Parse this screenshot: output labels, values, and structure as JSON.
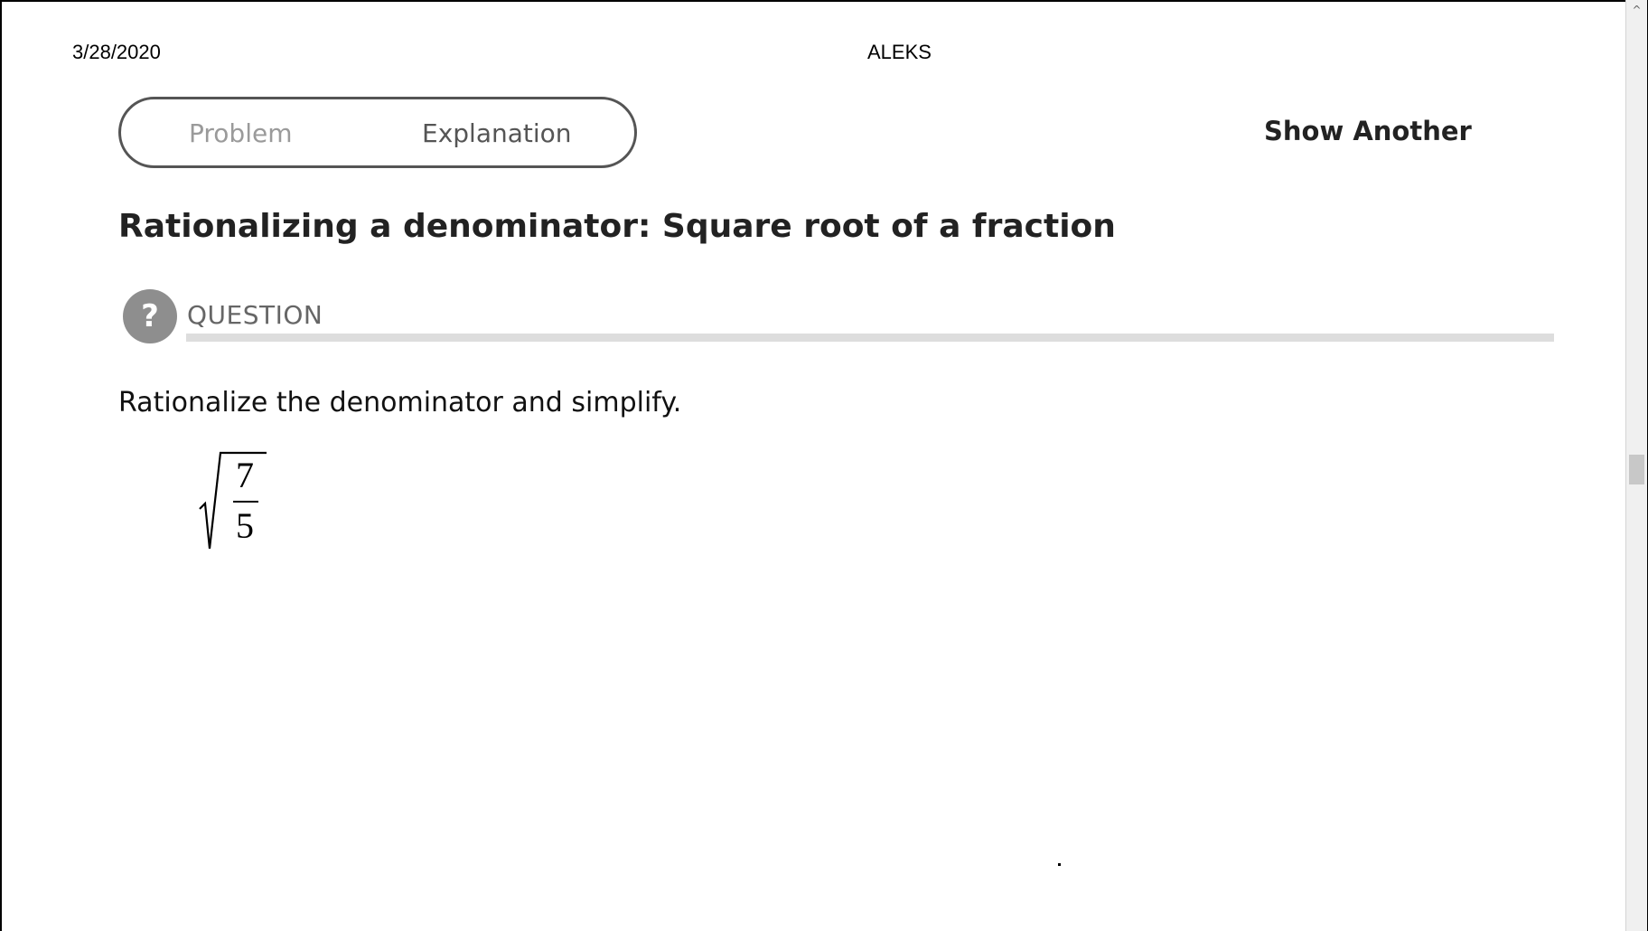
{
  "print_header": {
    "date": "3/28/2020",
    "title": "ALEKS"
  },
  "tabs": [
    {
      "label": "Problem",
      "active": false
    },
    {
      "label": "Explanation",
      "active": true
    }
  ],
  "toolbar": {
    "show_another_label": "Show Another"
  },
  "page_title": "Rationalizing a denominator: Square root of a fraction",
  "question_section": {
    "icon": "question-icon",
    "icon_glyph": "?",
    "label": "QUESTION"
  },
  "question": {
    "prompt": "Rationalize the denominator and simplify.",
    "expression": {
      "type": "sqrt-fraction",
      "numerator": "7",
      "denominator": "5"
    }
  },
  "scrollbar": {
    "up_arrow": "^"
  }
}
